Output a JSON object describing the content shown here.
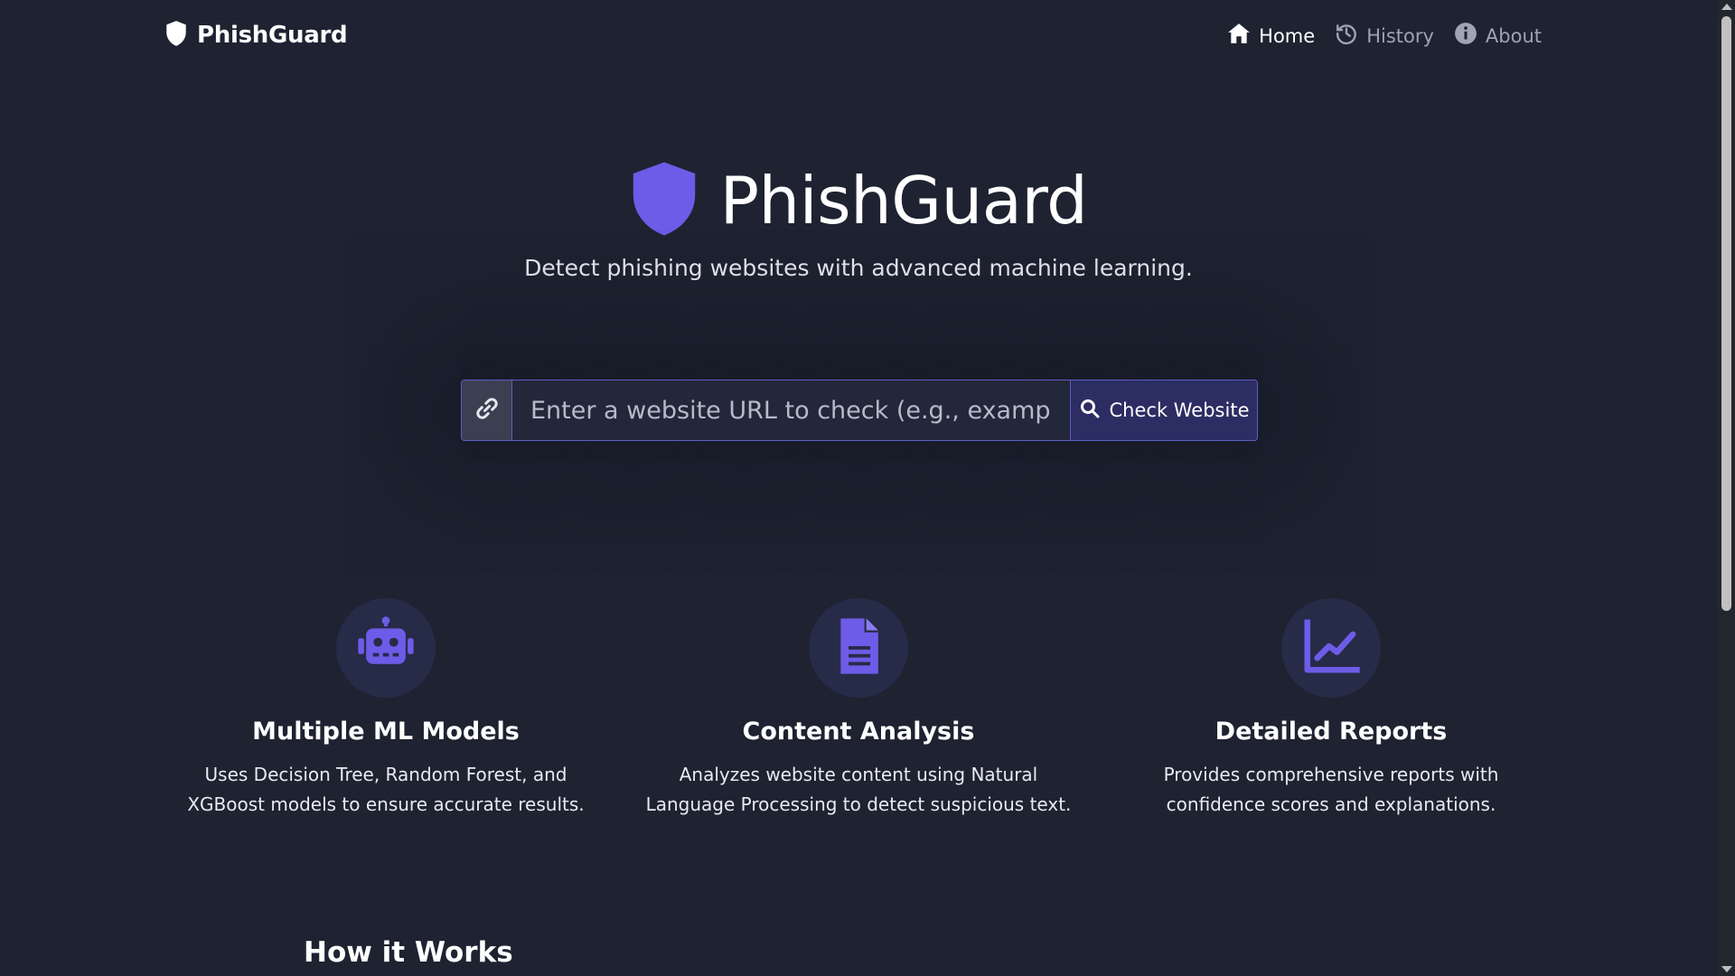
{
  "brand": {
    "name": "PhishGuard",
    "icon": "shield-icon"
  },
  "nav": {
    "items": [
      {
        "label": "Home",
        "icon": "home-icon",
        "active": true
      },
      {
        "label": "History",
        "icon": "history-icon",
        "active": false
      },
      {
        "label": "About",
        "icon": "info-icon",
        "active": false
      }
    ]
  },
  "hero": {
    "title": "PhishGuard",
    "subtitle": "Detect phishing websites with advanced machine learning.",
    "icon": "shield-icon"
  },
  "search": {
    "placeholder": "Enter a website URL to check (e.g., example.com)",
    "value": "",
    "button_label": "Check Website",
    "prefix_icon": "link-icon",
    "button_icon": "search-icon"
  },
  "features": [
    {
      "icon": "robot-icon",
      "title": "Multiple ML Models",
      "description": "Uses Decision Tree, Random Forest, and XGBoost models to ensure accurate results."
    },
    {
      "icon": "document-icon",
      "title": "Content Analysis",
      "description": "Analyzes website content using Natural Language Processing to detect suspicious text."
    },
    {
      "icon": "chart-line-icon",
      "title": "Detailed Reports",
      "description": "Provides comprehensive reports with confidence scores and explanations."
    }
  ],
  "how_it_works": {
    "title": "How it Works"
  },
  "colors": {
    "background": "#1e2231",
    "accent": "#6c5ce7",
    "icon_circle": "#262b48",
    "button_bg": "#2c2d63"
  }
}
